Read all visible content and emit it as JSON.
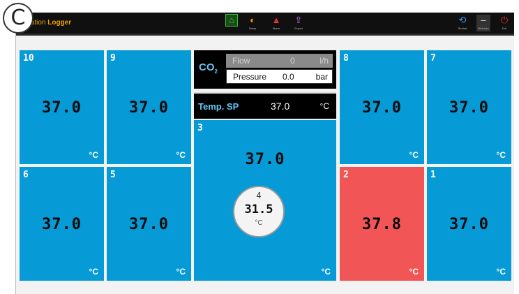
{
  "corner_label": "C",
  "app": {
    "title_prefix": "tation",
    "title_bold": "Logger"
  },
  "toolbar": {
    "center": [
      {
        "icon": "home-icon",
        "glyph": "⌂",
        "color": "#3bbf3b",
        "caption": ""
      },
      {
        "icon": "gauge-icon",
        "glyph": "◐",
        "color": "#f0a000",
        "caption": "Setup"
      },
      {
        "icon": "alarm-icon",
        "glyph": "▲",
        "color": "#e53030",
        "caption": "Alarm"
      },
      {
        "icon": "export-icon",
        "glyph": "⇪",
        "color": "#b070e0",
        "caption": "Export"
      }
    ],
    "right": [
      {
        "icon": "restart-icon",
        "glyph": "⟲",
        "color": "#3aa0ff",
        "caption": "Restart"
      },
      {
        "icon": "minimize-icon",
        "glyph": "–",
        "color": "#dddddd",
        "caption": "Minimize"
      },
      {
        "icon": "power-icon",
        "glyph": "⏻",
        "color": "#e53030",
        "caption": "Exit"
      }
    ]
  },
  "co2": {
    "label": "CO",
    "label_sub": "2",
    "flow": {
      "label": "Flow",
      "value": "0",
      "unit": "l/h"
    },
    "pressure": {
      "label": "Pressure",
      "value": "0.0",
      "unit": "bar"
    }
  },
  "setpoint": {
    "label": "Temp. SP",
    "value": "37.0",
    "unit": "°C"
  },
  "wells": [
    {
      "id": "10",
      "value": "37.0",
      "unit": "°C",
      "alarm": false
    },
    {
      "id": "9",
      "value": "37.0",
      "unit": "°C",
      "alarm": false
    },
    {
      "id": "8",
      "value": "37.0",
      "unit": "°C",
      "alarm": false
    },
    {
      "id": "7",
      "value": "37.0",
      "unit": "°C",
      "alarm": false
    },
    {
      "id": "6",
      "value": "37.0",
      "unit": "°C",
      "alarm": false
    },
    {
      "id": "5",
      "value": "37.0",
      "unit": "°C",
      "alarm": false
    },
    {
      "id": "3",
      "value": "37.0",
      "unit": "°C",
      "alarm": false
    },
    {
      "id": "2",
      "value": "37.8",
      "unit": "°C",
      "alarm": true
    },
    {
      "id": "1",
      "value": "37.0",
      "unit": "°C",
      "alarm": false
    }
  ],
  "inner_well": {
    "id": "4",
    "value": "31.5",
    "unit": "°C"
  }
}
